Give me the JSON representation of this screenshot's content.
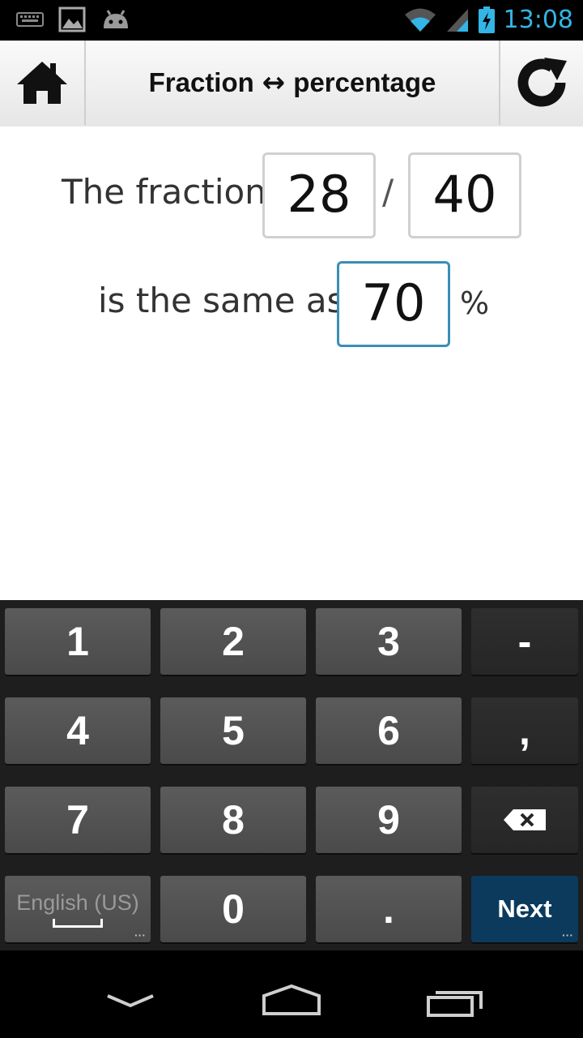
{
  "status_bar": {
    "time": "13:08",
    "icons": [
      "keyboard-icon",
      "image-icon",
      "android-icon",
      "wifi-icon",
      "signal-icon",
      "battery-charging-icon"
    ]
  },
  "action_bar": {
    "title_left": "Fraction",
    "title_arrow": "↔",
    "title_right": "percentage",
    "home_icon": "home-icon",
    "refresh_icon": "refresh-icon"
  },
  "converter": {
    "fraction_label": "The fraction",
    "numerator": "28",
    "slash": "/",
    "denominator": "40",
    "same_as_label": "is the same as",
    "percentage": "70",
    "percent_sign": "%"
  },
  "keyboard": {
    "keys": {
      "k1": "1",
      "k2": "2",
      "k3": "3",
      "minus": "-",
      "k4": "4",
      "k5": "5",
      "k6": "6",
      "comma": ",",
      "k7": "7",
      "k8": "8",
      "k9": "9",
      "language": "English (US)",
      "k0": "0",
      "period": ".",
      "next": "Next"
    }
  },
  "colors": {
    "status_time": "#33b5e5",
    "active_border": "#3a8eb5",
    "next_key": "#0b3a5d"
  }
}
